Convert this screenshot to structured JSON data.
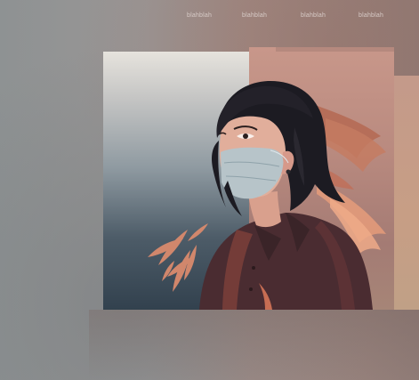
{
  "nav": {
    "items": [
      {
        "label": "blahblah"
      },
      {
        "label": "blahblah"
      },
      {
        "label": "blahblah"
      },
      {
        "label": "blahblah"
      }
    ]
  },
  "colors": {
    "background": "#969595",
    "panel_left_top": "#e6e3dd",
    "panel_left_bottom": "#32414e",
    "panel_right": "#b98a7f",
    "hair": "#1c1b22",
    "jacket": "#4a2c31",
    "leaves": "#d9866a",
    "mask": "#b7c4c9"
  }
}
